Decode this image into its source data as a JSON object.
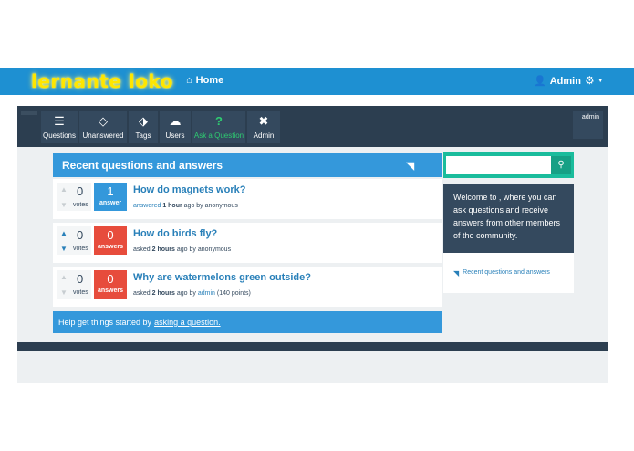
{
  "header": {
    "logo": "lernante loko",
    "home_label": "Home",
    "user_label": "Admin"
  },
  "nav": {
    "items": [
      {
        "label": "Questions",
        "icon": "list-icon"
      },
      {
        "label": "Unanswered",
        "icon": "unanswered-icon"
      },
      {
        "label": "Tags",
        "icon": "tag-icon"
      },
      {
        "label": "Users",
        "icon": "users-icon"
      },
      {
        "label": "Ask a Question",
        "icon": "question-icon"
      },
      {
        "label": "Admin",
        "icon": "tools-icon"
      }
    ],
    "admin_box": "admin"
  },
  "main": {
    "heading": "Recent questions and answers",
    "questions": [
      {
        "votes": "0",
        "votes_label": "votes",
        "answers": "1",
        "answers_label": "answer",
        "title": "How do magnets work?",
        "meta_action": "answered",
        "meta_time": "1 hour",
        "meta_ago": "ago by",
        "meta_user": "anonymous",
        "meta_points": ""
      },
      {
        "votes": "0",
        "votes_label": "votes",
        "answers": "0",
        "answers_label": "answers",
        "title": "How do birds fly?",
        "meta_action": "asked",
        "meta_time": "2 hours",
        "meta_ago": "ago by",
        "meta_user": "anonymous",
        "meta_points": ""
      },
      {
        "votes": "0",
        "votes_label": "votes",
        "answers": "0",
        "answers_label": "answers",
        "title": "Why are watermelons green outside?",
        "meta_action": "asked",
        "meta_time": "2 hours",
        "meta_ago": "ago by",
        "meta_user": "admin",
        "meta_points": "(140 points)"
      }
    ],
    "help_text": "Help get things started by",
    "help_link": "asking a question."
  },
  "sidebar": {
    "search_value": "",
    "welcome": "Welcome to , where you can ask questions and receive answers from other members of the community.",
    "recent_link": "Recent questions and answers"
  },
  "colors": {
    "topbar": "#1e90d2",
    "nav": "#2c3e50",
    "accent": "#3498db",
    "danger": "#e74c3c",
    "search": "#1abc9c"
  }
}
